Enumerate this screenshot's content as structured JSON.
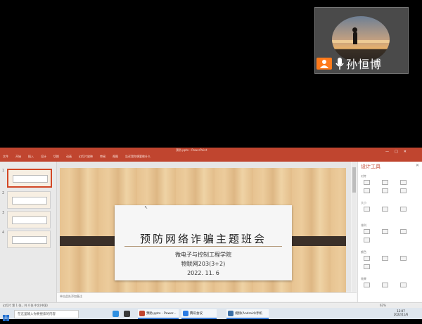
{
  "video_tile": {
    "participant_name": "孙恒博",
    "host_icon": "user-icon",
    "mic_icon": "microphone-icon"
  },
  "ppt": {
    "window_title": "预防.pptx - PowerPoint",
    "menu": [
      "文件",
      "开始",
      "插入",
      "设计",
      "切换",
      "动画",
      "幻灯片放映",
      "审阅",
      "视图",
      "告诉我你想要做什么"
    ],
    "thumbnail_numbers": [
      "1",
      "2",
      "3",
      "4"
    ],
    "slide": {
      "title": "预防网络诈骗主题班会",
      "college": "微电子与控制工程学院",
      "class": "物联网203(3+2)",
      "date": "2022. 11. 6"
    },
    "notes_placeholder": "单击此处添加备注",
    "design_pane_title": "设计工具",
    "design_sections": [
      "对齐",
      "大小",
      "排列",
      "颜色",
      "效果"
    ],
    "status_left": "幻灯片 第 1 张，共 4 张    中文(中国)",
    "zoom": "62%"
  },
  "taskbar": {
    "search_placeholder": "在这里输入你要搜索的内容",
    "apps": [
      "预防.pptx - Power...",
      "腾讯会议",
      "视频(Android)手机"
    ],
    "time": "13:07",
    "date": "2022/11/6"
  },
  "colors": {
    "ribbon": "#c0452f",
    "host_badge": "#ff7a1a",
    "slide_strip": "#3b3029"
  }
}
